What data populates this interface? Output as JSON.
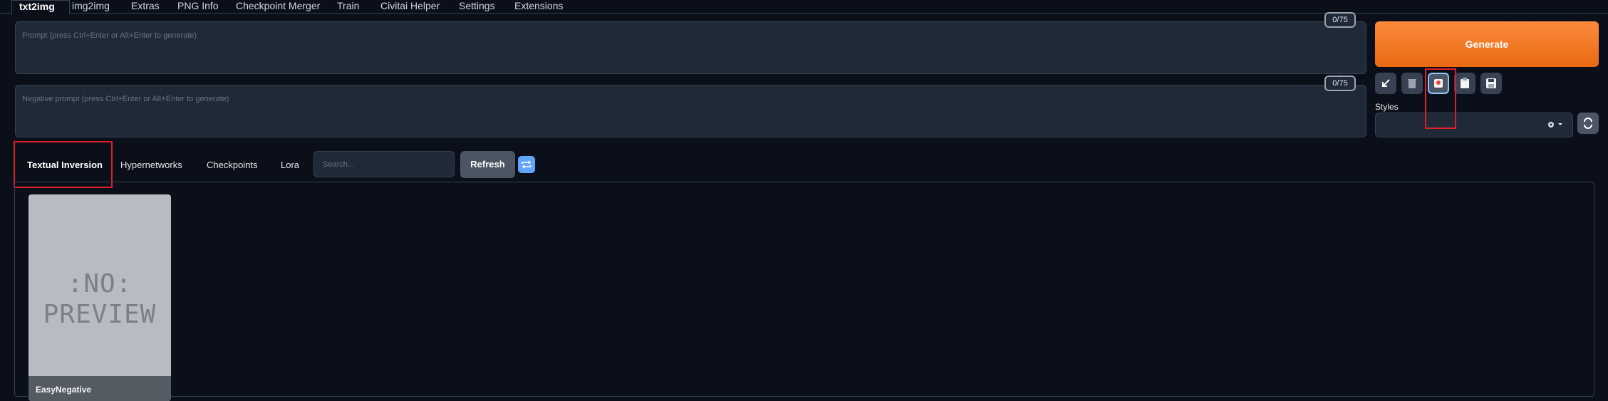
{
  "top_tabs": [
    "txt2img",
    "img2img",
    "Extras",
    "PNG Info",
    "Checkpoint Merger",
    "Train",
    "Civitai Helper",
    "Settings",
    "Extensions"
  ],
  "prompt": {
    "placeholder": "Prompt (press Ctrl+Enter or Alt+Enter to generate)",
    "token_count": "0/75"
  },
  "negative_prompt": {
    "placeholder": "Negative prompt (press Ctrl+Enter or Alt+Enter to generate)",
    "token_count": "0/75"
  },
  "generate_label": "Generate",
  "tool_icons": [
    "arrow-down-left-icon",
    "trash-icon",
    "red-dot-icon",
    "clipboard-icon",
    "save-icon"
  ],
  "styles": {
    "label": "Styles",
    "value": ""
  },
  "extra_tabs": [
    "Textual Inversion",
    "Hypernetworks",
    "Checkpoints",
    "Lora"
  ],
  "search": {
    "placeholder": "Search..."
  },
  "refresh_label": "Refresh",
  "card": {
    "preview_text_line1": ":NO:",
    "preview_text_line2": "PREVIEW",
    "name": "EasyNegative"
  },
  "colors": {
    "accent": "#f97316",
    "highlight": "#e11d2a",
    "background": "#0b0f19"
  }
}
